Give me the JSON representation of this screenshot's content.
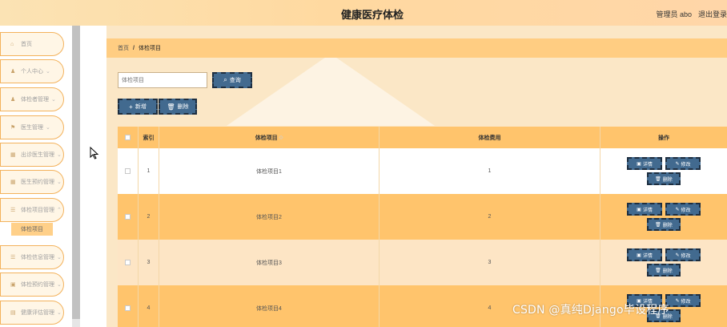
{
  "header": {
    "title": "健康医疗体检",
    "user": "管理员 abo",
    "logout": "退出登录"
  },
  "sidebar": {
    "items": [
      {
        "label": "首页",
        "icon": "home-icon"
      },
      {
        "label": "个人中心",
        "icon": "user-icon"
      },
      {
        "label": "体检者管理",
        "icon": "user-icon"
      },
      {
        "label": "医生管理",
        "icon": "flag-icon"
      },
      {
        "label": "出诊医生管理",
        "icon": "grid-icon"
      },
      {
        "label": "医生预约管理",
        "icon": "grid-icon"
      },
      {
        "label": "体检项目管理",
        "icon": "list-icon"
      },
      {
        "label": "体检信息管理",
        "icon": "list-icon"
      },
      {
        "label": "体检预约管理",
        "icon": "box-icon"
      },
      {
        "label": "健康评估管理",
        "icon": "doc-icon"
      }
    ],
    "active_sub_item": "体检项目"
  },
  "breadcrumb": {
    "home": "首页",
    "separator": "/",
    "current": "体检项目"
  },
  "search": {
    "placeholder": "体检项目",
    "query_label": "查询"
  },
  "actions": {
    "add_label": "新增",
    "delete_label": "删除"
  },
  "table": {
    "columns": [
      "索引",
      "体检项目",
      "体检费用",
      "操作"
    ],
    "rows": [
      {
        "index": "1",
        "item": "体检项目1",
        "fee": "1"
      },
      {
        "index": "2",
        "item": "体检项目2",
        "fee": "2"
      },
      {
        "index": "3",
        "item": "体检项目3",
        "fee": "3"
      },
      {
        "index": "4",
        "item": "体检项目4",
        "fee": "4"
      }
    ],
    "row_actions": {
      "detail": "详情",
      "edit": "修改",
      "delete": "删除"
    }
  },
  "watermark": "CSDN @真纯Django毕设程序",
  "colors": {
    "accent": "#ffc46c",
    "button": "#426a8f",
    "background": "#fbe7c6"
  }
}
